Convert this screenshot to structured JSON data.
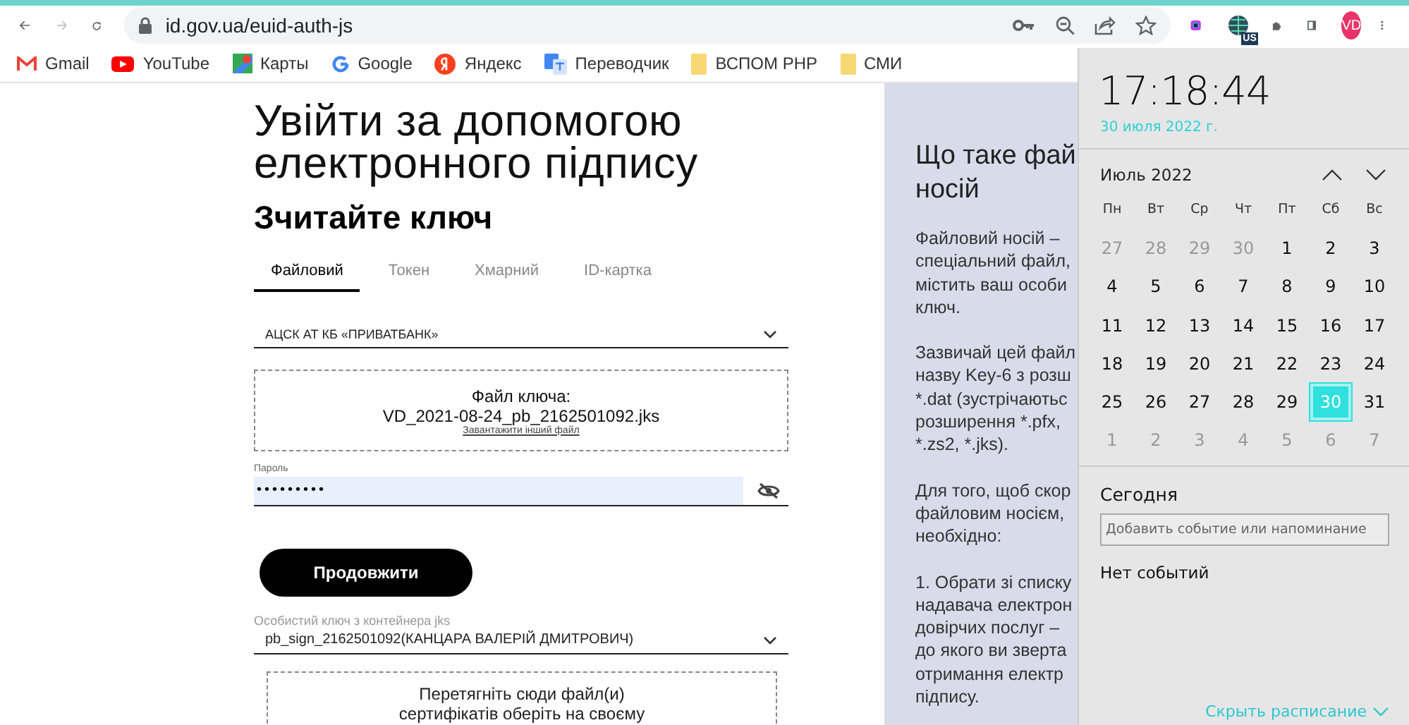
{
  "browser": {
    "address": "id.gov.ua/euid-auth-js",
    "extension_badge": "US",
    "profile_initials": "VD",
    "bookmarks": [
      {
        "label": "Gmail",
        "kind": "gmail"
      },
      {
        "label": "YouTube",
        "kind": "youtube"
      },
      {
        "label": "Карты",
        "kind": "maps"
      },
      {
        "label": "Google",
        "kind": "google"
      },
      {
        "label": "Яндекс",
        "kind": "yandex"
      },
      {
        "label": "Переводчик",
        "kind": "translate"
      },
      {
        "label": "ВСПОМ PHP",
        "kind": "folder"
      },
      {
        "label": "СМИ",
        "kind": "folder"
      }
    ]
  },
  "form": {
    "title": "Увійти за допомогою електронного підпису",
    "heading": "Зчитайте ключ",
    "tabs": [
      {
        "label": "Файловий",
        "selected": true
      },
      {
        "label": "Токен",
        "selected": false
      },
      {
        "label": "Хмарний",
        "selected": false
      },
      {
        "label": "ID-картка",
        "selected": false
      }
    ],
    "provider_select": {
      "value": "АЦСК АТ КБ «ПРИВАТБАНК»"
    },
    "key_file": {
      "label": "Файл ключа:",
      "file_name": "VD_2021-08-24_pb_2162501092.jks",
      "link": "Завантажити інший файл"
    },
    "password": {
      "label": "Пароль",
      "value": "•••••••••"
    },
    "continue_button": "Продовжити",
    "key_select": {
      "label": "Особистий ключ з контейнера jks",
      "value": "pb_sign_2162501092(КАНЦАРА ВАЛЕРІЙ ДМИТРОВИЧ)"
    },
    "drop_area": {
      "lines": [
        "Перетягніть сюди файл(и)",
        "сертифікатів оберіть на своєму"
      ]
    }
  },
  "info_panel": {
    "title_lines": [
      "Що таке фай",
      "носій"
    ],
    "paragraphs": [
      [
        "Файловий носій –",
        "спеціальний файл,",
        "містить ваш особи",
        "ключ."
      ],
      [
        "Зазвичай цей файл",
        "назву Key-6 з розш",
        "*.dat (зустрічаютьс",
        "розширення *.pfx,",
        "*.zs2, *.jks)."
      ],
      [
        "Для того, щоб скор",
        "файловим носієм,",
        "необхідно:"
      ],
      [
        "1. Обрати зі списку",
        "надавача електрон",
        "довірчих послуг –",
        "до якого ви зверта",
        "отримання електр",
        "підпису."
      ]
    ]
  },
  "calendar": {
    "time": "17:18:44",
    "date": "30 июля 2022 г.",
    "month": "Июль 2022",
    "weekdays": [
      "Пн",
      "Вт",
      "Ср",
      "Чт",
      "Пт",
      "Сб",
      "Вс"
    ],
    "weeks": [
      [
        {
          "day": "27",
          "other_month": true,
          "selected": false
        },
        {
          "day": "28",
          "other_month": true,
          "selected": false
        },
        {
          "day": "29",
          "other_month": true,
          "selected": false
        },
        {
          "day": "30",
          "other_month": true,
          "selected": false
        },
        {
          "day": "1",
          "other_month": false,
          "selected": false
        },
        {
          "day": "2",
          "other_month": false,
          "selected": false
        },
        {
          "day": "3",
          "other_month": false,
          "selected": false
        }
      ],
      [
        {
          "day": "4",
          "other_month": false,
          "selected": false
        },
        {
          "day": "5",
          "other_month": false,
          "selected": false
        },
        {
          "day": "6",
          "other_month": false,
          "selected": false
        },
        {
          "day": "7",
          "other_month": false,
          "selected": false
        },
        {
          "day": "8",
          "other_month": false,
          "selected": false
        },
        {
          "day": "9",
          "other_month": false,
          "selected": false
        },
        {
          "day": "10",
          "other_month": false,
          "selected": false
        }
      ],
      [
        {
          "day": "11",
          "other_month": false,
          "selected": false
        },
        {
          "day": "12",
          "other_month": false,
          "selected": false
        },
        {
          "day": "13",
          "other_month": false,
          "selected": false
        },
        {
          "day": "14",
          "other_month": false,
          "selected": false
        },
        {
          "day": "15",
          "other_month": false,
          "selected": false
        },
        {
          "day": "16",
          "other_month": false,
          "selected": false
        },
        {
          "day": "17",
          "other_month": false,
          "selected": false
        }
      ],
      [
        {
          "day": "18",
          "other_month": false,
          "selected": false
        },
        {
          "day": "19",
          "other_month": false,
          "selected": false
        },
        {
          "day": "20",
          "other_month": false,
          "selected": false
        },
        {
          "day": "21",
          "other_month": false,
          "selected": false
        },
        {
          "day": "22",
          "other_month": false,
          "selected": false
        },
        {
          "day": "23",
          "other_month": false,
          "selected": false
        },
        {
          "day": "24",
          "other_month": false,
          "selected": false
        }
      ],
      [
        {
          "day": "25",
          "other_month": false,
          "selected": false
        },
        {
          "day": "26",
          "other_month": false,
          "selected": false
        },
        {
          "day": "27",
          "other_month": false,
          "selected": false
        },
        {
          "day": "28",
          "other_month": false,
          "selected": false
        },
        {
          "day": "29",
          "other_month": false,
          "selected": false
        },
        {
          "day": "30",
          "other_month": false,
          "selected": true
        },
        {
          "day": "31",
          "other_month": false,
          "selected": false
        }
      ],
      [
        {
          "day": "1",
          "other_month": true,
          "selected": false
        },
        {
          "day": "2",
          "other_month": true,
          "selected": false
        },
        {
          "day": "3",
          "other_month": true,
          "selected": false
        },
        {
          "day": "4",
          "other_month": true,
          "selected": false
        },
        {
          "day": "5",
          "other_month": true,
          "selected": false
        },
        {
          "day": "6",
          "other_month": true,
          "selected": false
        },
        {
          "day": "7",
          "other_month": true,
          "selected": false
        }
      ]
    ],
    "today_label": "Сегодня",
    "event_field": {
      "placeholder": "Добавить событие или напоминание"
    },
    "no_events": "Нет событий",
    "hide_schedule_link": "Скрыть расписание"
  }
}
